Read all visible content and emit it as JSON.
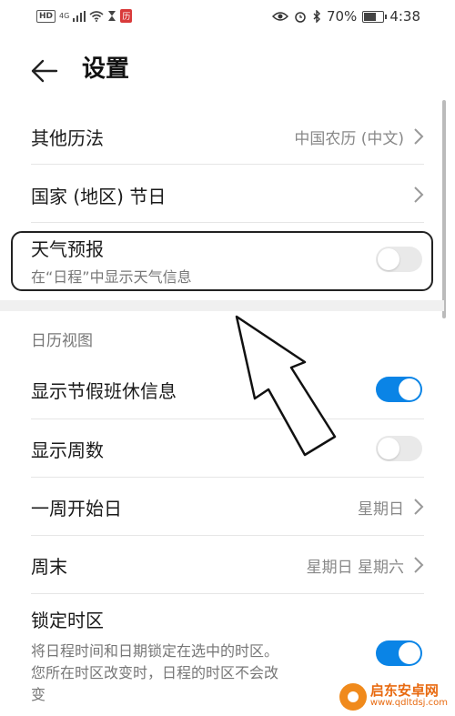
{
  "status": {
    "hd": "HD",
    "network": "4G",
    "battery": "70%",
    "time": "4:38",
    "battery_level": 0.7
  },
  "header": {
    "title": "设置"
  },
  "rows": {
    "other_calendar": {
      "label": "其他历法",
      "value": "中国农历 (中文)"
    },
    "holidays": {
      "label": "国家 (地区) 节日"
    },
    "weather": {
      "label": "天气预报",
      "sub": "在“日程”中显示天气信息",
      "enabled": false
    },
    "show_holiday": {
      "label": "显示节假班休信息",
      "enabled": true
    },
    "show_week": {
      "label": "显示周数",
      "enabled": false
    },
    "week_start": {
      "label": "一周开始日",
      "value": "星期日"
    },
    "weekend": {
      "label": "周末",
      "value": "星期日 星期六"
    },
    "lock_tz": {
      "label": "锁定时区",
      "sub1": "将日程时间和日期锁定在选中的时区。",
      "sub2": "您所在时区改变时，日程的时区不会改",
      "sub3": "变",
      "enabled": true
    }
  },
  "section": {
    "calendar_view": "日历视图"
  },
  "watermark": {
    "title": "启东安卓网",
    "url": "www.qdltdsj.com"
  },
  "colors": {
    "toggle_on": "#0a84e6",
    "toggle_off": "#e9e9e9"
  }
}
